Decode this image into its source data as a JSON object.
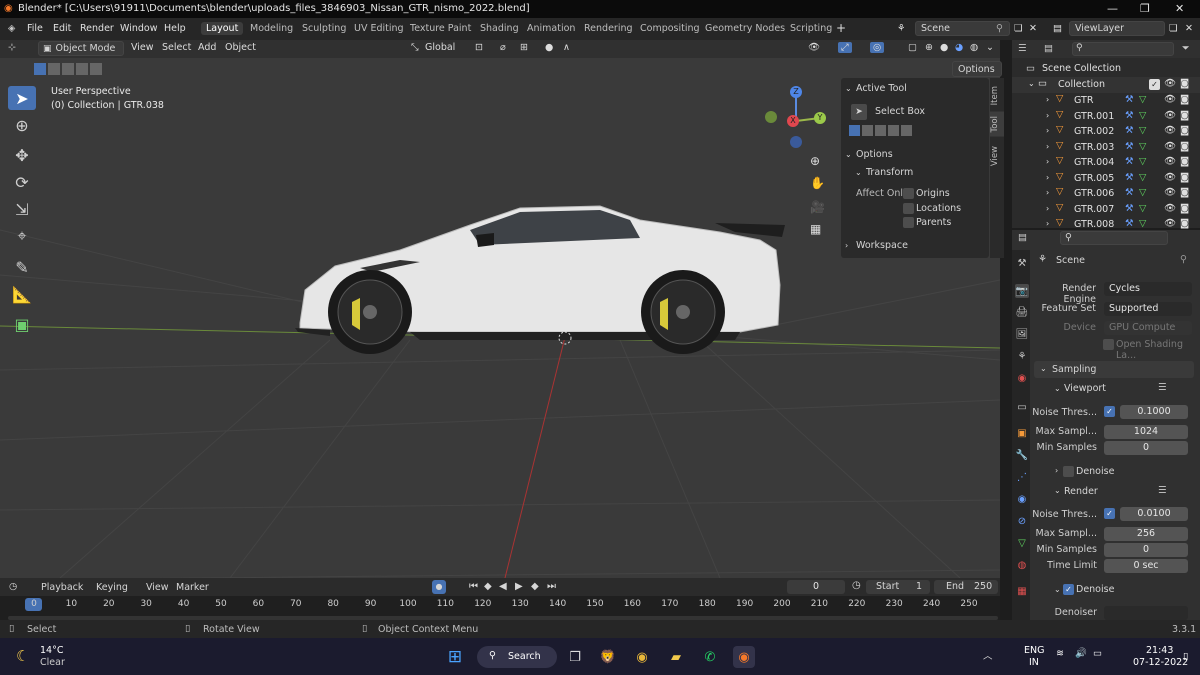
{
  "window": {
    "title": "Blender* [C:\\Users\\91911\\Documents\\blender\\uploads_files_3846903_Nissan_GTR_nismo_2022.blend]"
  },
  "menus": [
    "File",
    "Edit",
    "Render",
    "Window",
    "Help"
  ],
  "workspaces": [
    "Layout",
    "Modeling",
    "Sculpting",
    "UV Editing",
    "Texture Paint",
    "Shading",
    "Animation",
    "Rendering",
    "Compositing",
    "Geometry Nodes",
    "Scripting"
  ],
  "scene_label": "Scene",
  "viewlayer_label": "ViewLayer",
  "viewport": {
    "mode": "Object Mode",
    "menu": [
      "View",
      "Select",
      "Add",
      "Object"
    ],
    "orientation": "Global",
    "options": "Options",
    "perspective": "User Perspective",
    "collection_info": "(0) Collection | GTR.038",
    "gizmo": {
      "x": "X",
      "y": "Y",
      "z": "Z"
    }
  },
  "npanel": {
    "active_tool": "Active Tool",
    "select_box": "Select Box",
    "options": "Options",
    "transform": "Transform",
    "affect_only": "Affect Only",
    "origins": "Origins",
    "locations": "Locations",
    "parents": "Parents",
    "workspace": "Workspace",
    "tabs": [
      "Item",
      "Tool",
      "View"
    ]
  },
  "outliner": {
    "scene_collection": "Scene Collection",
    "collection": "Collection",
    "items": [
      "GTR",
      "GTR.001",
      "GTR.002",
      "GTR.003",
      "GTR.004",
      "GTR.005",
      "GTR.006",
      "GTR.007",
      "GTR.008"
    ]
  },
  "properties": {
    "scene": "Scene",
    "render_engine_label": "Render Engine",
    "render_engine": "Cycles",
    "feature_set_label": "Feature Set",
    "feature_set": "Supported",
    "device_label": "Device",
    "device": "GPU Compute",
    "open_shading": "Open Shading La...",
    "sampling": "Sampling",
    "viewport": "Viewport",
    "noise_thresh_label": "Noise Thres...",
    "vp_noise": "0.1000",
    "max_samples_label": "Max Sampl...",
    "vp_max": "1024",
    "min_samples_label": "Min Samples",
    "vp_min": "0",
    "denoise": "Denoise",
    "render": "Render",
    "r_noise": "0.0100",
    "r_max": "256",
    "r_min": "0",
    "time_limit_label": "Time Limit",
    "r_time": "0 sec",
    "denoise2": "Denoise",
    "denoiser": "Denoiser"
  },
  "timeline": {
    "menu": [
      "Playback",
      "Keying",
      "View",
      "Marker"
    ],
    "current": "0",
    "start_label": "Start",
    "start": "1",
    "end_label": "End",
    "end": "250",
    "ticks": [
      "0",
      "10",
      "20",
      "30",
      "40",
      "50",
      "60",
      "70",
      "80",
      "90",
      "100",
      "110",
      "120",
      "130",
      "140",
      "150",
      "160",
      "170",
      "180",
      "190",
      "200",
      "210",
      "220",
      "230",
      "240",
      "250"
    ]
  },
  "statusbar": {
    "select": "Select",
    "rotate": "Rotate View",
    "context": "Object Context Menu",
    "version": "3.3.1"
  },
  "taskbar": {
    "temp": "14°C",
    "weather": "Clear",
    "search": "Search",
    "lang1": "ENG",
    "lang2": "IN",
    "time": "21:43",
    "date": "07-12-2022"
  }
}
